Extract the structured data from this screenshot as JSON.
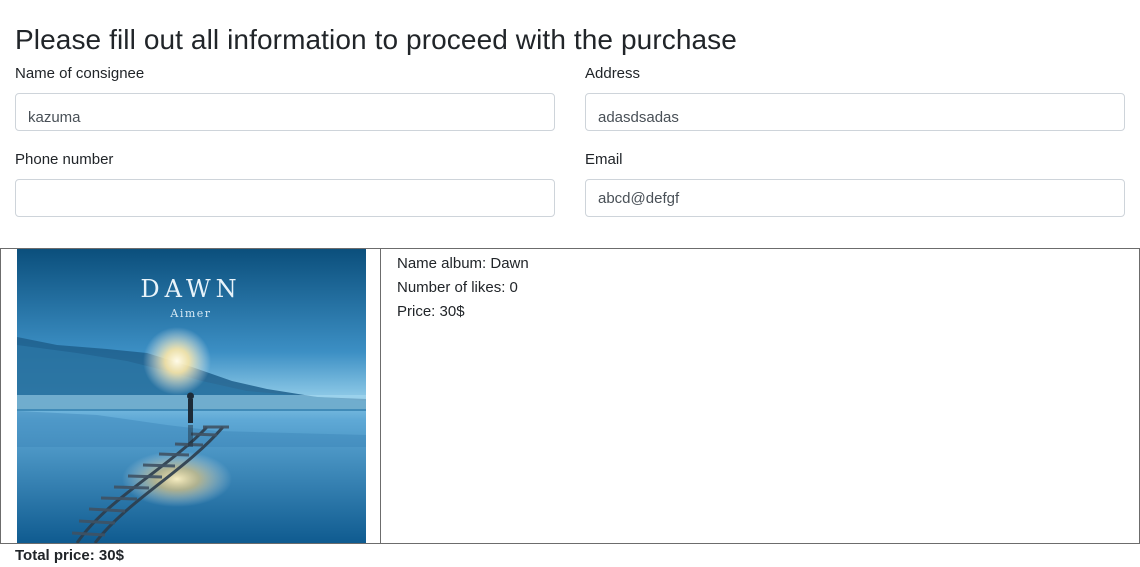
{
  "page": {
    "title": "Please fill out all information to proceed with the purchase"
  },
  "form": {
    "consignee": {
      "label": "Name of consignee",
      "value": "kazuma",
      "placeholder": ""
    },
    "address": {
      "label": "Address",
      "value": "adasdsadas",
      "placeholder": ""
    },
    "phone": {
      "label": "Phone number",
      "value": "",
      "placeholder": ""
    },
    "email": {
      "label": "Email",
      "value": "abcd@defgf",
      "placeholder": ""
    }
  },
  "album": {
    "cover_title": "DAWN",
    "cover_artist": "Aimer",
    "name_line": "Name album: Dawn",
    "likes_line": "Number of likes: 0",
    "price_line": "Price: 30$"
  },
  "summary": {
    "total_price": "Total price: 30$"
  },
  "colors": {
    "text": "#212529",
    "input_border": "#ced4da",
    "table_border": "#6c6c6c"
  }
}
